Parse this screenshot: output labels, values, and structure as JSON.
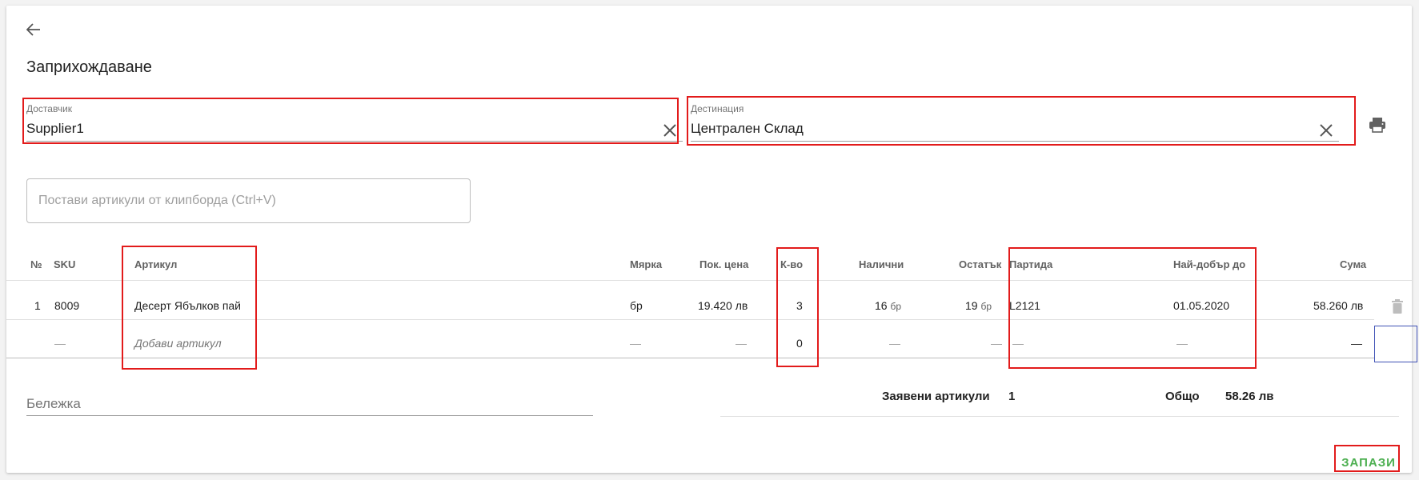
{
  "header": {
    "title": "Заприхождаване",
    "back_icon": "arrow-left-icon"
  },
  "supplier": {
    "label": "Доставчик",
    "value": "Supplier1"
  },
  "destination": {
    "label": "Дестинация",
    "value": "Централен Склад"
  },
  "paste": {
    "placeholder": "Постави артикули от клипборда (Ctrl+V)"
  },
  "table": {
    "headers": {
      "no": "№",
      "sku": "SKU",
      "article": "Артикул",
      "unit": "Мярка",
      "price": "Пок. цена",
      "qty": "К-во",
      "available": "Налични",
      "remaining": "Остатък",
      "batch": "Партида",
      "best_before": "Най-добър до",
      "sum": "Сума"
    },
    "rows": [
      {
        "no": "1",
        "sku": "8009",
        "article": "Десерт Ябълков пай",
        "unit": "бр",
        "price": "19.420 лв",
        "qty": "3",
        "available": "16",
        "available_unit": "бр",
        "remaining": "19",
        "remaining_unit": "бр",
        "batch": "L2121",
        "best_before": "01.05.2020",
        "sum": "58.260 лв"
      }
    ],
    "new_row": {
      "sku": "—",
      "article_placeholder": "Добави артикул",
      "unit": "—",
      "price": "—",
      "qty": "0",
      "available": "—",
      "remaining": "—",
      "batch": "—",
      "best_before": "—",
      "sum": "—"
    }
  },
  "note": {
    "placeholder": "Бележка"
  },
  "summary": {
    "ordered_label": "Заявени артикули",
    "ordered_value": "1",
    "total_label": "Общо",
    "total_value": "58.26 лв"
  },
  "actions": {
    "save_label": "ЗАПАЗИ"
  },
  "colors": {
    "highlight": "#e21b1b",
    "save": "#4caf50",
    "focus": "#3f51b5"
  }
}
